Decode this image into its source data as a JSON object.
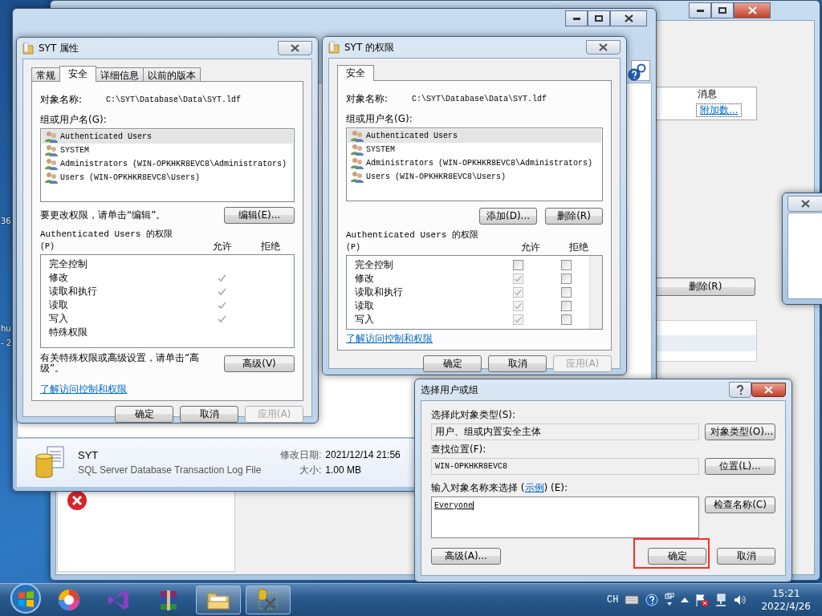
{
  "desktop_labels": [
    "36",
    "hu",
    "- 2"
  ],
  "background_window": {
    "column_header": "消息",
    "link": "附加数...",
    "delete_button": "删除(R)"
  },
  "explorer_window": {
    "file_name": "SYT",
    "file_type": "SQL Server Database Transaction Log File",
    "modified_label": "修改日期:",
    "modified_value": "2021/12/14 21:56",
    "size_label": "大小:",
    "size_value": "1.00 MB"
  },
  "properties_dialog": {
    "title": "SYT 属性",
    "tabs": [
      {
        "label": "常规",
        "selected": false
      },
      {
        "label": "安全",
        "selected": true
      },
      {
        "label": "详细信息",
        "selected": false
      },
      {
        "label": "以前的版本",
        "selected": false
      }
    ],
    "object_label": "对象名称:",
    "object_path": "C:\\SYT\\Database\\Data\\SYT.ldf",
    "group_label": "组或用户名(G):",
    "users": [
      {
        "name": "Authenticated Users",
        "selected": true
      },
      {
        "name": "SYSTEM",
        "selected": false
      },
      {
        "name": "Administrators (WIN-OPKHKR8EVC8\\Administrators)",
        "selected": false
      },
      {
        "name": "Users (WIN-OPKHKR8EVC8\\Users)",
        "selected": false
      }
    ],
    "change_hint": "要更改权限，请单击“编辑”。",
    "edit_button": "编辑(E)...",
    "perm_title": "Authenticated Users 的权限",
    "perm_key": "(P)",
    "allow_header": "允许",
    "deny_header": "拒绝",
    "permissions": [
      {
        "name": "完全控制",
        "allow": false,
        "deny": false
      },
      {
        "name": "修改",
        "allow": true,
        "deny": false
      },
      {
        "name": "读取和执行",
        "allow": true,
        "deny": false
      },
      {
        "name": "读取",
        "allow": true,
        "deny": false
      },
      {
        "name": "写入",
        "allow": true,
        "deny": false
      },
      {
        "name": "特殊权限",
        "allow": false,
        "deny": false
      }
    ],
    "advanced_hint": "有关特殊权限或高级设置，请单击“高级”。",
    "advanced_button": "高级(V)",
    "link": "了解访问控制和权限",
    "buttons": [
      {
        "label": "确定",
        "disabled": false
      },
      {
        "label": "取消",
        "disabled": false
      },
      {
        "label": "应用(A)",
        "disabled": true
      }
    ]
  },
  "permissions_dialog": {
    "title": "SYT 的权限",
    "tabs": [
      {
        "label": "安全",
        "selected": true
      }
    ],
    "object_label": "对象名称:",
    "object_path": "C:\\SYT\\Database\\Data\\SYT.ldf",
    "group_label": "组或用户名(G):",
    "users": [
      {
        "name": "Authenticated Users",
        "selected": true
      },
      {
        "name": "SYSTEM",
        "selected": false
      },
      {
        "name": "Administrators (WIN-OPKHKR8EVC8\\Administrators)",
        "selected": false
      },
      {
        "name": "Users (WIN-OPKHKR8EVC8\\Users)",
        "selected": false
      }
    ],
    "add_button": "添加(D)...",
    "remove_button": "删除(R)",
    "perm_title": "Authenticated Users 的权限",
    "perm_key": "(P)",
    "allow_header": "允许",
    "deny_header": "拒绝",
    "permissions": [
      {
        "name": "完全控制",
        "allow": false,
        "allow_disabled": false,
        "deny": false
      },
      {
        "name": "修改",
        "allow": true,
        "allow_disabled": true,
        "deny": false
      },
      {
        "name": "读取和执行",
        "allow": true,
        "allow_disabled": true,
        "deny": false
      },
      {
        "name": "读取",
        "allow": true,
        "allow_disabled": true,
        "deny": false
      },
      {
        "name": "写入",
        "allow": true,
        "allow_disabled": true,
        "deny": false
      }
    ],
    "link": "了解访问控制和权限",
    "buttons": [
      {
        "label": "确定",
        "disabled": false
      },
      {
        "label": "取消",
        "disabled": false
      },
      {
        "label": "应用(A)",
        "disabled": true
      }
    ]
  },
  "select_dialog": {
    "title": "选择用户或组",
    "type_label": "选择此对象类型(S):",
    "type_value": "用户、组或内置安全主体",
    "type_button": "对象类型(O)...",
    "location_label": "查找位置(F):",
    "location_value": "WIN-OPKHKR8EVC8",
    "location_button": "位置(L)...",
    "input_label_before": "输入对象名称来选择 (",
    "example_link": "示例",
    "input_label_after": ") (E):",
    "input_value": "Everyone",
    "check_button": "检查名称(C)",
    "advanced_button": "高级(A)...",
    "ok_button": "确定",
    "ok_highlighted": true,
    "cancel_button": "取消"
  },
  "taskbar": {
    "apps": [
      {
        "kind": "wheel",
        "active": false
      },
      {
        "kind": "ribbon",
        "active": false
      },
      {
        "kind": "books",
        "active": false
      },
      {
        "kind": "folder",
        "active": true
      },
      {
        "kind": "tools",
        "active": true
      }
    ],
    "language": "CH",
    "time": "15:21",
    "date": "2022/4/26"
  }
}
